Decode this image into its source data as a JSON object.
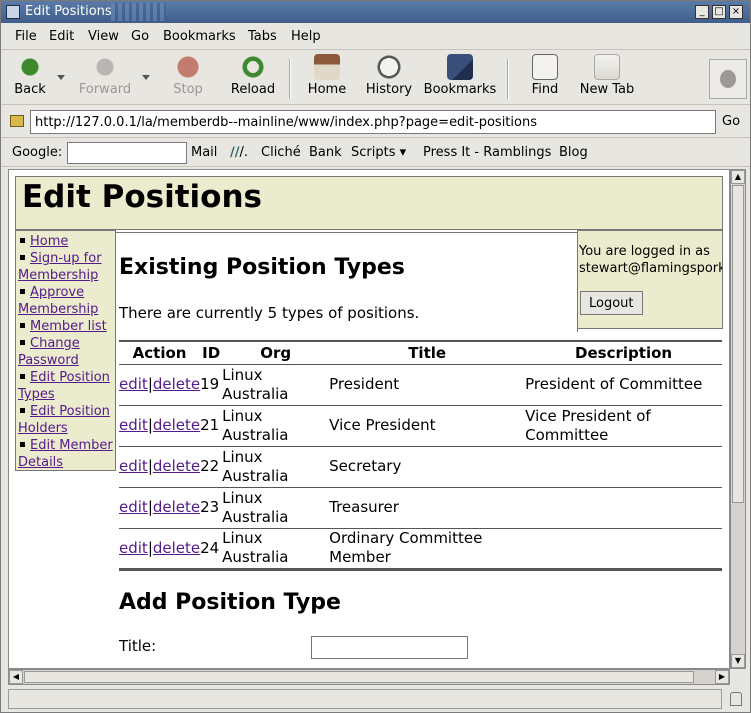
{
  "window": {
    "title": "Edit Positions"
  },
  "menu": [
    "File",
    "Edit",
    "View",
    "Go",
    "Bookmarks",
    "Tabs",
    "Help"
  ],
  "toolbar": {
    "back": "Back",
    "forward": "Forward",
    "stop": "Stop",
    "reload": "Reload",
    "home": "Home",
    "history": "History",
    "bookmarks": "Bookmarks",
    "find": "Find",
    "new_tab": "New Tab"
  },
  "urlbar": {
    "url": "http://127.0.0.1/la/memberdb--mainline/www/index.php?page=edit-positions",
    "go": "Go"
  },
  "personal_bar": {
    "google": "Google:",
    "mail": "Mail",
    "slashdot": "/.",
    "cliche": "Cliché",
    "bank": "Bank",
    "scripts": "Scripts",
    "pressit": "Press It - Ramblings",
    "blog": "Blog"
  },
  "page": {
    "heading": "Edit Positions",
    "nav": [
      "Home",
      "Sign-up for Membership",
      "Approve Membership",
      "Member list",
      "Change Password",
      "Edit Position Types",
      "Edit Position Holders",
      "Edit Member Details"
    ],
    "login": {
      "line1": "You are logged in as",
      "line2": "stewart@flamingspork.c",
      "logout": "Logout"
    },
    "existing_title": "Existing Position Types",
    "count_text": "There are currently 5 types of positions.",
    "table": {
      "headers": [
        "Action",
        "ID",
        "Org",
        "Title",
        "Description"
      ],
      "edit": "edit",
      "sep": "|",
      "delete": "delete",
      "rows": [
        {
          "id": "19",
          "org": "Linux Australia",
          "title": "President",
          "desc": "President of Committee"
        },
        {
          "id": "21",
          "org": "Linux Australia",
          "title": "Vice President",
          "desc": "Vice President of Committee"
        },
        {
          "id": "22",
          "org": "Linux Australia",
          "title": "Secretary",
          "desc": ""
        },
        {
          "id": "23",
          "org": "Linux Australia",
          "title": "Treasurer",
          "desc": ""
        },
        {
          "id": "24",
          "org": "Linux Australia",
          "title": "Ordinary Committee Member",
          "desc": ""
        }
      ]
    },
    "add_title": "Add Position Type",
    "title_label": "Title:"
  }
}
